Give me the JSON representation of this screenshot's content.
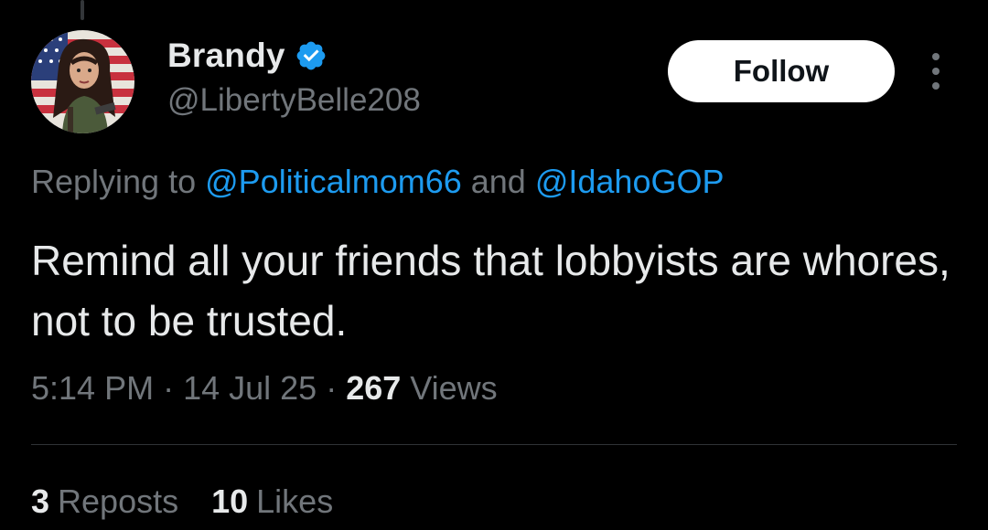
{
  "author": {
    "display_name": "Brandy",
    "handle": "@LibertyBelle208",
    "verified_icon": "verified-badge-icon",
    "verified_color": "#1d9bf0",
    "avatar_icon": "profile-avatar"
  },
  "actions": {
    "follow_label": "Follow",
    "more_icon": "more-vertical-icon"
  },
  "reply": {
    "prefix": "Replying to ",
    "mention_1": "@Politicalmom66",
    "joiner": " and ",
    "mention_2": "@IdahoGOP"
  },
  "tweet": {
    "text": "Remind all your friends that lobbyists are whores, not to be trusted."
  },
  "meta": {
    "time": "5:14 PM",
    "separator": " · ",
    "date": "14 Jul 25",
    "views_count": "267",
    "views_label": "Views"
  },
  "stats": {
    "reposts_count": "3",
    "reposts_label": "Reposts",
    "likes_count": "10",
    "likes_label": "Likes"
  },
  "colors": {
    "background": "#000000",
    "text_primary": "#e7e9ea",
    "text_secondary": "#71767b",
    "link": "#1d9bf0",
    "divider": "#2f3336"
  }
}
